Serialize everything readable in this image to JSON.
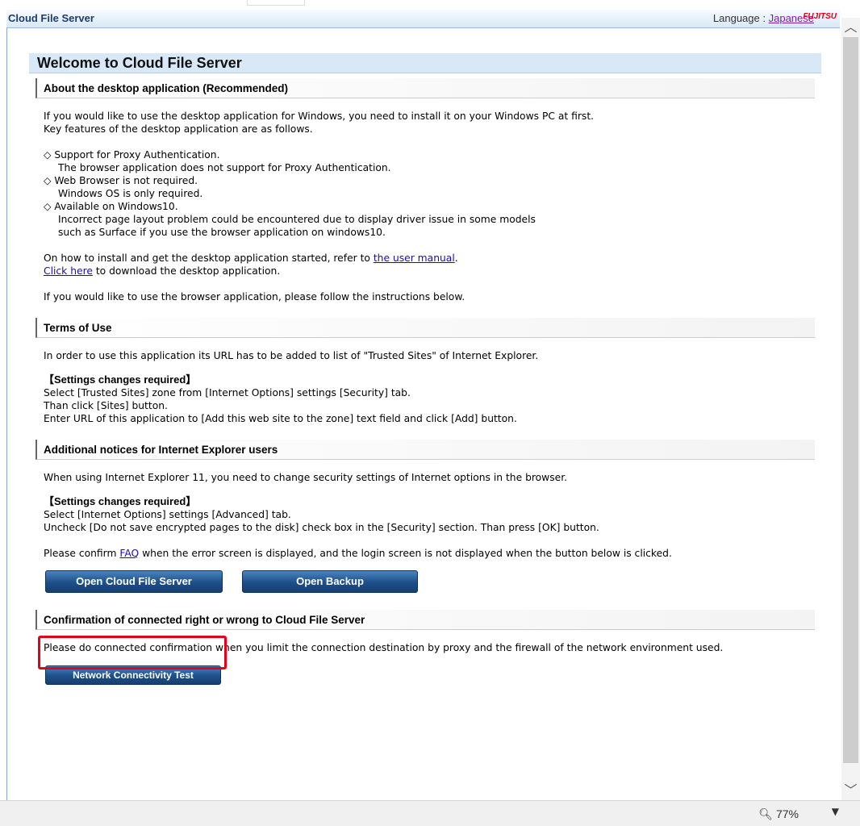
{
  "header": {
    "app_title": "Cloud File Server",
    "language_label": "Language :",
    "language_link": "Japanese",
    "logo_text": "FUJITSU"
  },
  "page_title": "Welcome to Cloud File Server",
  "sections": {
    "desktop": {
      "heading": "About the desktop application (Recommended)",
      "intro1": "If you would like to use the desktop application for Windows, you need to install it on your Windows PC at first.",
      "intro2": "Key features of the desktop application are as follows.",
      "f1_title": "◇ Support for Proxy Authentication.",
      "f1_desc": "The browser application does not support for Proxy Authentication.",
      "f2_title": "◇ Web Browser is not required.",
      "f2_desc": "Windows OS is only required.",
      "f3_title": "◇ Available on Windows10.",
      "f3_desc1": "Incorrect page layout problem could be encountered due to display driver issue in some models",
      "f3_desc2": "such as Surface if you use the browser application on windows10.",
      "manual_pre": "On how to install and get the desktop application started, refer to ",
      "manual_link": "the user manual",
      "manual_post": ".",
      "download_link": "Click here",
      "download_post": " to download the desktop application.",
      "browser_note": "If you would like to use the browser application, please follow the instructions below."
    },
    "terms": {
      "heading": "Terms of Use",
      "intro": "In order to use this application its URL has to be added to list of \"Trusted Sites\" of Internet Explorer.",
      "settings_title": "【Settings changes required】",
      "s1": "Select [Trusted Sites] zone from [Internet Options] settings [Security] tab.",
      "s2": "Than click [Sites] button.",
      "s3": "Enter URL of this application to [Add this web site to the zone] text field and click [Add] button."
    },
    "ie": {
      "heading": "Additional notices for Internet Explorer users",
      "intro": "When using Internet Explorer 11, you need to change security settings of Internet options in the browser.",
      "settings_title": "【Settings changes required】",
      "s1": "Select [Internet Options] settings [Advanced] tab.",
      "s2": "Uncheck [Do not save encrypted pages to the disk] check box in the [Security] section. Than press [OK] button.",
      "faq_pre": "Please confirm ",
      "faq_link": "FAQ",
      "faq_post": " when the error screen is displayed, and the login screen is not displayed when the button below is clicked.",
      "open_button": "Open Cloud File Server",
      "backup_button": "Open Backup"
    },
    "connect": {
      "heading": "Confirmation of connected right or wrong to Cloud File Server",
      "intro": "Please do connected confirmation when you limit the connection destination by proxy and the firewall of the network environment used.",
      "test_button": "Network Connectivity Test"
    }
  },
  "statusbar": {
    "zoom": "77%"
  }
}
